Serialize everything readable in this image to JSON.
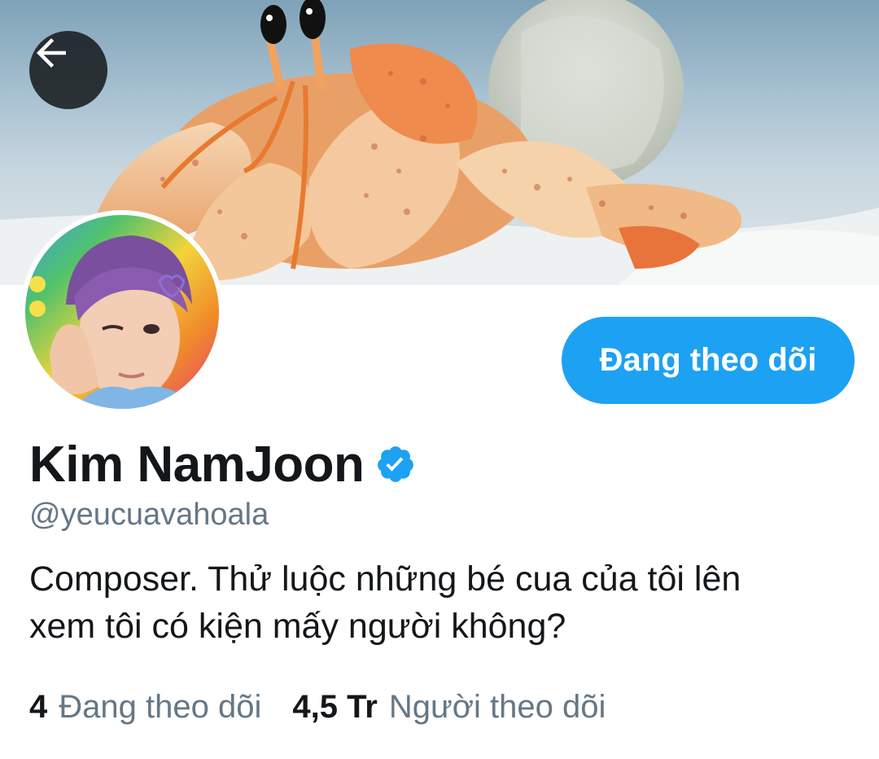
{
  "header": {
    "back_icon": "arrow-left-icon",
    "banner_image": "hermit-crab-photo"
  },
  "profile": {
    "avatar_image": "profile-photo",
    "display_name": "Kim NamJoon",
    "verified_icon": "verified-badge-icon",
    "handle": "@yeucuavahoala",
    "bio_line1": "Composer. Thử luộc những bé cua của tôi lên",
    "bio_line2": "xem tôi có kiện mấy người không?",
    "follow_button_label": "Đang theo dõi"
  },
  "stats": {
    "following_count": "4",
    "following_label": "Đang theo dõi",
    "followers_count": "4,5 Tr",
    "followers_label": "Người theo dõi"
  },
  "colors": {
    "accent": "#1da1f2",
    "secondary_text": "#657786",
    "primary_text": "#14171a"
  }
}
